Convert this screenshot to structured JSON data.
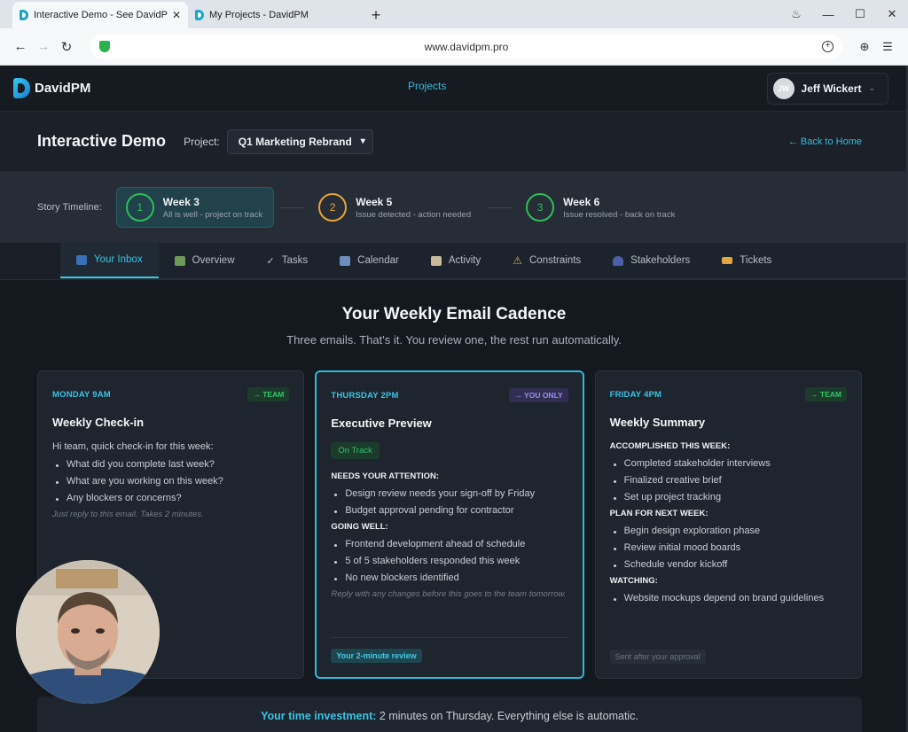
{
  "browser": {
    "tabs": [
      {
        "title": "Interactive Demo - See DavidP",
        "active": true
      },
      {
        "title": "My Projects - DavidPM",
        "active": false
      }
    ],
    "url": "www.davidpm.pro"
  },
  "app": {
    "brand": "DavidPM",
    "nav_projects": "Projects",
    "user_initials": "JW",
    "user_name": "Jeff Wickert"
  },
  "demo": {
    "title": "Interactive Demo",
    "project_label": "Project:",
    "project_value": "Q1 Marketing Rebrand",
    "back_link": "← Back to Home"
  },
  "timeline": {
    "label": "Story Timeline:",
    "steps": [
      {
        "num": "1",
        "title": "Week 3",
        "subtitle": "All is well - project on track"
      },
      {
        "num": "2",
        "title": "Week 5",
        "subtitle": "Issue detected - action needed"
      },
      {
        "num": "3",
        "title": "Week 6",
        "subtitle": "Issue resolved - back on track"
      }
    ]
  },
  "tabs": [
    "Your Inbox",
    "Overview",
    "Tasks",
    "Calendar",
    "Activity",
    "Constraints",
    "Stakeholders",
    "Tickets"
  ],
  "main": {
    "heading": "Your Weekly Email Cadence",
    "subheading": "Three emails. That's it. You review one, the rest run automatically."
  },
  "cards": {
    "monday": {
      "when": "MONDAY 9AM",
      "tag": "→ TEAM",
      "title": "Weekly Check-in",
      "intro": "Hi team, quick check-in for this week:",
      "items": [
        "What did you complete last week?",
        "What are you working on this week?",
        "Any blockers or concerns?"
      ],
      "note": "Just reply to this email. Takes 2 minutes."
    },
    "thursday": {
      "when": "THURSDAY 2PM",
      "tag": "→ YOU ONLY",
      "title": "Executive Preview",
      "status": "On Track",
      "attention_label": "NEEDS YOUR ATTENTION:",
      "attention": [
        "Design review needs your sign-off by Friday",
        "Budget approval pending for contractor"
      ],
      "going_label": "GOING WELL:",
      "going": [
        "Frontend development ahead of schedule",
        "5 of 5 stakeholders responded this week",
        "No new blockers identified"
      ],
      "note": "Reply with any changes before this goes to the team tomorrow.",
      "footer": "Your 2-minute review"
    },
    "friday": {
      "when": "FRIDAY 4PM",
      "tag": "→ TEAM",
      "title": "Weekly Summary",
      "accomplished_label": "ACCOMPLISHED THIS WEEK:",
      "accomplished": [
        "Completed stakeholder interviews",
        "Finalized creative brief",
        "Set up project tracking"
      ],
      "plan_label": "PLAN FOR NEXT WEEK:",
      "plan": [
        "Begin design exploration phase",
        "Review initial mood boards",
        "Schedule vendor kickoff"
      ],
      "watching_label": "WATCHING:",
      "watching": [
        "Website mockups depend on brand guidelines"
      ],
      "footer": "Sent after your approval"
    }
  },
  "investment": {
    "label": "Your time investment:",
    "text": " 2 minutes on Thursday. Everything else is automatic."
  },
  "colors": {
    "accent": "#3bc3e3",
    "success": "#36c46a",
    "warning": "#e7a33a",
    "purple": "#9b8df0"
  }
}
